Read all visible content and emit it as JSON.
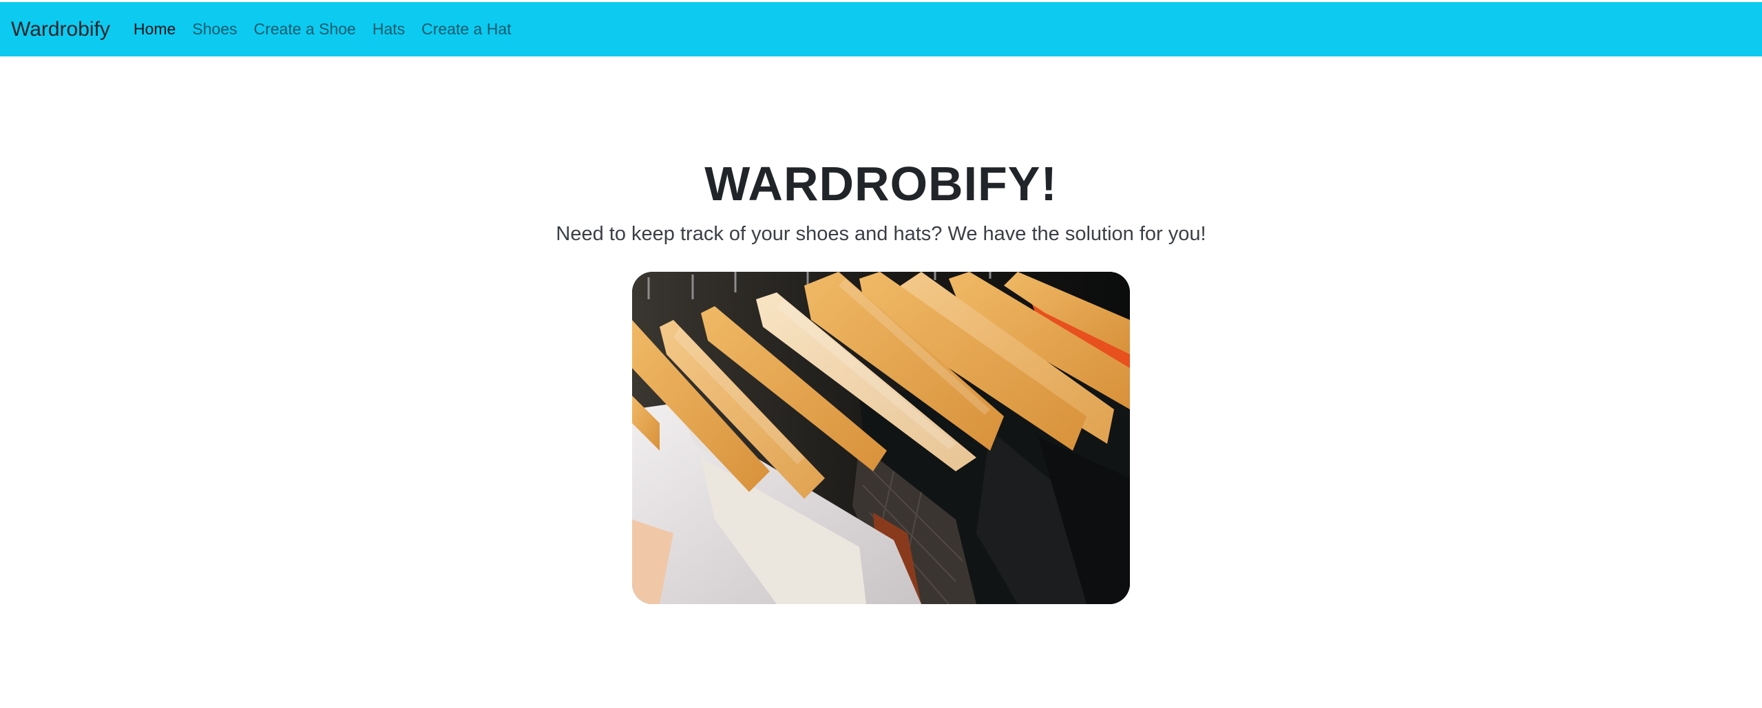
{
  "navbar": {
    "brand": "Wardrobify",
    "links": [
      {
        "label": "Home",
        "active": true
      },
      {
        "label": "Shoes",
        "active": false
      },
      {
        "label": "Create a Shoe",
        "active": false
      },
      {
        "label": "Hats",
        "active": false
      },
      {
        "label": "Create a Hat",
        "active": false
      }
    ],
    "background_color": "#0dcaf0"
  },
  "hero": {
    "title": "WARDROBIFY!",
    "lead": "Need to keep track of your shoes and hats? We have the solution for you!",
    "image_subject": "clothes-on-wooden-hangers"
  }
}
